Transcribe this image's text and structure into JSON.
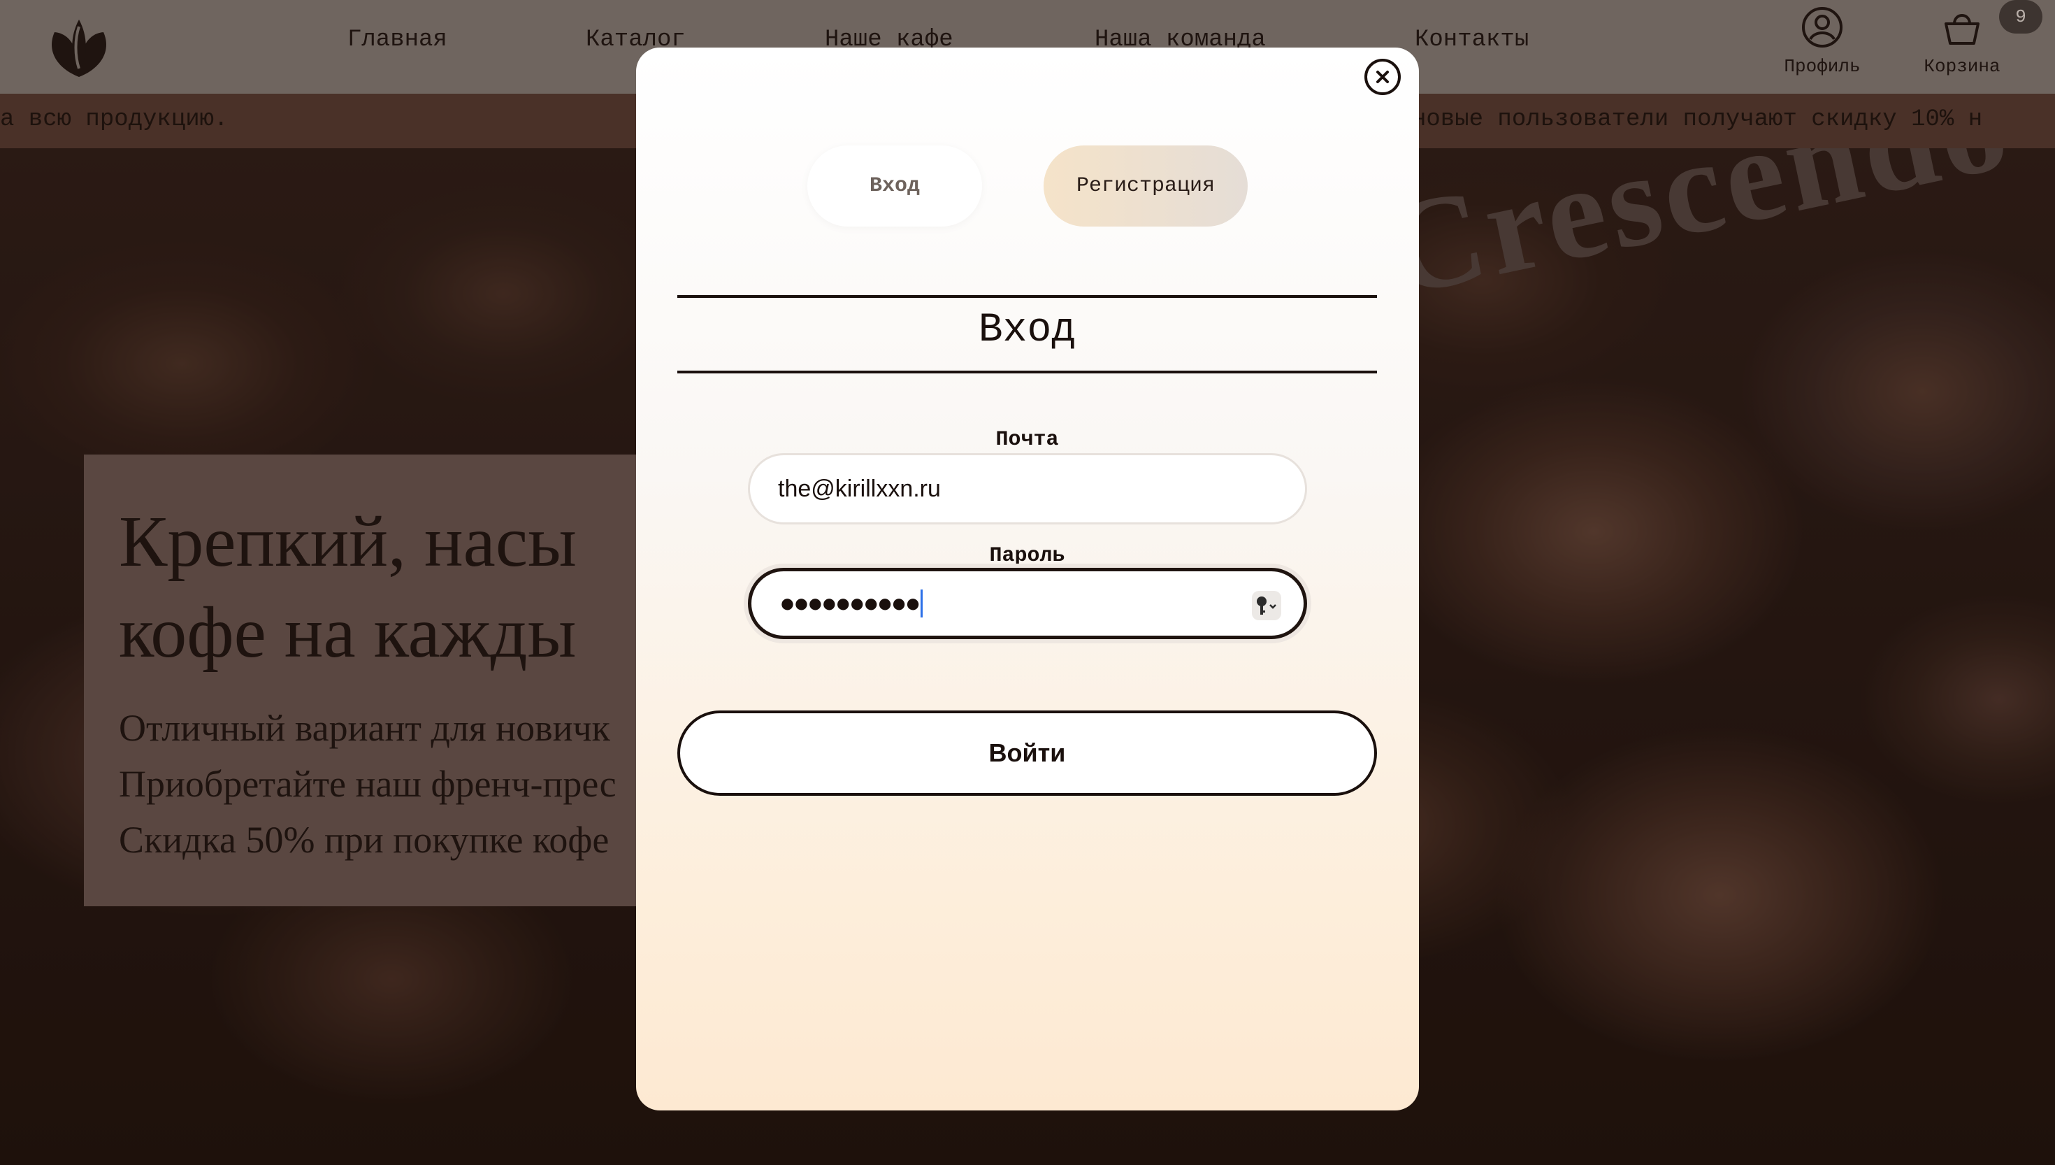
{
  "header": {
    "nav": [
      "Главная",
      "Каталог",
      "Наше кафе",
      "Наша команда",
      "Контакты"
    ],
    "profile_label": "Профиль",
    "cart_label": "Корзина",
    "cart_count": "9"
  },
  "ticker": {
    "left_text": "а всю продукцию.",
    "right_text": "новые пользователи получают скидку 10% н"
  },
  "hero": {
    "brand": "Crescendo",
    "promo_title_1": "Крепкий, насы",
    "promo_title_2": "кофе на кажды",
    "promo_line_1": "Отличный вариант для новичк",
    "promo_line_2": "Приобретайте наш френч-прес",
    "promo_line_3": "Скидка 50% при покупке кофе"
  },
  "modal": {
    "tab_login": "Вход",
    "tab_register": "Регистрация",
    "title": "Вход",
    "email_label": "Почта",
    "email_value": "the@kirillxxn.ru",
    "password_label": "Пароль",
    "password_value": "●●●●●●●●●●",
    "submit_label": "Войти"
  },
  "icons": [
    "logo-icon",
    "profile-icon",
    "cart-icon",
    "close-icon",
    "password-key-icon"
  ]
}
